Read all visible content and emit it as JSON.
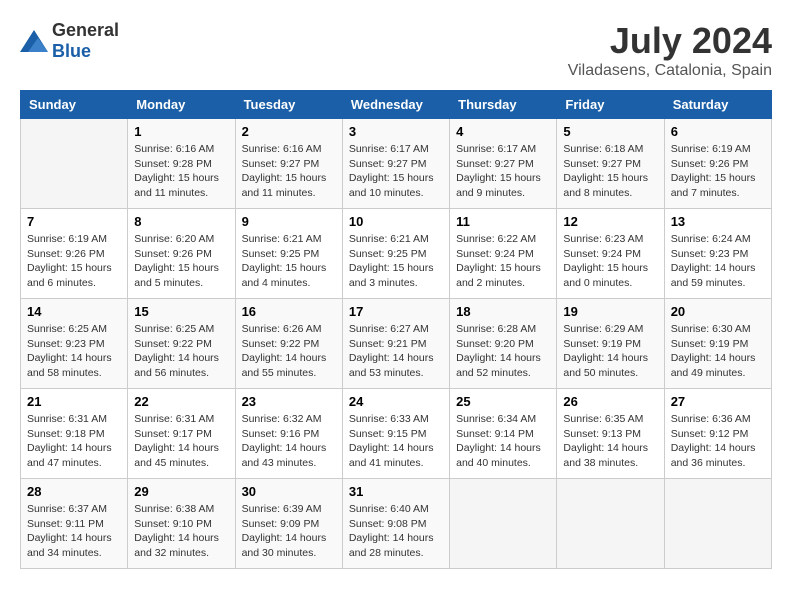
{
  "logo": {
    "text_general": "General",
    "text_blue": "Blue"
  },
  "header": {
    "month": "July 2024",
    "location": "Viladasens, Catalonia, Spain"
  },
  "weekdays": [
    "Sunday",
    "Monday",
    "Tuesday",
    "Wednesday",
    "Thursday",
    "Friday",
    "Saturday"
  ],
  "weeks": [
    [
      {
        "day": "",
        "sunrise": "",
        "sunset": "",
        "daylight": ""
      },
      {
        "day": "1",
        "sunrise": "Sunrise: 6:16 AM",
        "sunset": "Sunset: 9:28 PM",
        "daylight": "Daylight: 15 hours and 11 minutes."
      },
      {
        "day": "2",
        "sunrise": "Sunrise: 6:16 AM",
        "sunset": "Sunset: 9:27 PM",
        "daylight": "Daylight: 15 hours and 11 minutes."
      },
      {
        "day": "3",
        "sunrise": "Sunrise: 6:17 AM",
        "sunset": "Sunset: 9:27 PM",
        "daylight": "Daylight: 15 hours and 10 minutes."
      },
      {
        "day": "4",
        "sunrise": "Sunrise: 6:17 AM",
        "sunset": "Sunset: 9:27 PM",
        "daylight": "Daylight: 15 hours and 9 minutes."
      },
      {
        "day": "5",
        "sunrise": "Sunrise: 6:18 AM",
        "sunset": "Sunset: 9:27 PM",
        "daylight": "Daylight: 15 hours and 8 minutes."
      },
      {
        "day": "6",
        "sunrise": "Sunrise: 6:19 AM",
        "sunset": "Sunset: 9:26 PM",
        "daylight": "Daylight: 15 hours and 7 minutes."
      }
    ],
    [
      {
        "day": "7",
        "sunrise": "Sunrise: 6:19 AM",
        "sunset": "Sunset: 9:26 PM",
        "daylight": "Daylight: 15 hours and 6 minutes."
      },
      {
        "day": "8",
        "sunrise": "Sunrise: 6:20 AM",
        "sunset": "Sunset: 9:26 PM",
        "daylight": "Daylight: 15 hours and 5 minutes."
      },
      {
        "day": "9",
        "sunrise": "Sunrise: 6:21 AM",
        "sunset": "Sunset: 9:25 PM",
        "daylight": "Daylight: 15 hours and 4 minutes."
      },
      {
        "day": "10",
        "sunrise": "Sunrise: 6:21 AM",
        "sunset": "Sunset: 9:25 PM",
        "daylight": "Daylight: 15 hours and 3 minutes."
      },
      {
        "day": "11",
        "sunrise": "Sunrise: 6:22 AM",
        "sunset": "Sunset: 9:24 PM",
        "daylight": "Daylight: 15 hours and 2 minutes."
      },
      {
        "day": "12",
        "sunrise": "Sunrise: 6:23 AM",
        "sunset": "Sunset: 9:24 PM",
        "daylight": "Daylight: 15 hours and 0 minutes."
      },
      {
        "day": "13",
        "sunrise": "Sunrise: 6:24 AM",
        "sunset": "Sunset: 9:23 PM",
        "daylight": "Daylight: 14 hours and 59 minutes."
      }
    ],
    [
      {
        "day": "14",
        "sunrise": "Sunrise: 6:25 AM",
        "sunset": "Sunset: 9:23 PM",
        "daylight": "Daylight: 14 hours and 58 minutes."
      },
      {
        "day": "15",
        "sunrise": "Sunrise: 6:25 AM",
        "sunset": "Sunset: 9:22 PM",
        "daylight": "Daylight: 14 hours and 56 minutes."
      },
      {
        "day": "16",
        "sunrise": "Sunrise: 6:26 AM",
        "sunset": "Sunset: 9:22 PM",
        "daylight": "Daylight: 14 hours and 55 minutes."
      },
      {
        "day": "17",
        "sunrise": "Sunrise: 6:27 AM",
        "sunset": "Sunset: 9:21 PM",
        "daylight": "Daylight: 14 hours and 53 minutes."
      },
      {
        "day": "18",
        "sunrise": "Sunrise: 6:28 AM",
        "sunset": "Sunset: 9:20 PM",
        "daylight": "Daylight: 14 hours and 52 minutes."
      },
      {
        "day": "19",
        "sunrise": "Sunrise: 6:29 AM",
        "sunset": "Sunset: 9:19 PM",
        "daylight": "Daylight: 14 hours and 50 minutes."
      },
      {
        "day": "20",
        "sunrise": "Sunrise: 6:30 AM",
        "sunset": "Sunset: 9:19 PM",
        "daylight": "Daylight: 14 hours and 49 minutes."
      }
    ],
    [
      {
        "day": "21",
        "sunrise": "Sunrise: 6:31 AM",
        "sunset": "Sunset: 9:18 PM",
        "daylight": "Daylight: 14 hours and 47 minutes."
      },
      {
        "day": "22",
        "sunrise": "Sunrise: 6:31 AM",
        "sunset": "Sunset: 9:17 PM",
        "daylight": "Daylight: 14 hours and 45 minutes."
      },
      {
        "day": "23",
        "sunrise": "Sunrise: 6:32 AM",
        "sunset": "Sunset: 9:16 PM",
        "daylight": "Daylight: 14 hours and 43 minutes."
      },
      {
        "day": "24",
        "sunrise": "Sunrise: 6:33 AM",
        "sunset": "Sunset: 9:15 PM",
        "daylight": "Daylight: 14 hours and 41 minutes."
      },
      {
        "day": "25",
        "sunrise": "Sunrise: 6:34 AM",
        "sunset": "Sunset: 9:14 PM",
        "daylight": "Daylight: 14 hours and 40 minutes."
      },
      {
        "day": "26",
        "sunrise": "Sunrise: 6:35 AM",
        "sunset": "Sunset: 9:13 PM",
        "daylight": "Daylight: 14 hours and 38 minutes."
      },
      {
        "day": "27",
        "sunrise": "Sunrise: 6:36 AM",
        "sunset": "Sunset: 9:12 PM",
        "daylight": "Daylight: 14 hours and 36 minutes."
      }
    ],
    [
      {
        "day": "28",
        "sunrise": "Sunrise: 6:37 AM",
        "sunset": "Sunset: 9:11 PM",
        "daylight": "Daylight: 14 hours and 34 minutes."
      },
      {
        "day": "29",
        "sunrise": "Sunrise: 6:38 AM",
        "sunset": "Sunset: 9:10 PM",
        "daylight": "Daylight: 14 hours and 32 minutes."
      },
      {
        "day": "30",
        "sunrise": "Sunrise: 6:39 AM",
        "sunset": "Sunset: 9:09 PM",
        "daylight": "Daylight: 14 hours and 30 minutes."
      },
      {
        "day": "31",
        "sunrise": "Sunrise: 6:40 AM",
        "sunset": "Sunset: 9:08 PM",
        "daylight": "Daylight: 14 hours and 28 minutes."
      },
      {
        "day": "",
        "sunrise": "",
        "sunset": "",
        "daylight": ""
      },
      {
        "day": "",
        "sunrise": "",
        "sunset": "",
        "daylight": ""
      },
      {
        "day": "",
        "sunrise": "",
        "sunset": "",
        "daylight": ""
      }
    ]
  ]
}
